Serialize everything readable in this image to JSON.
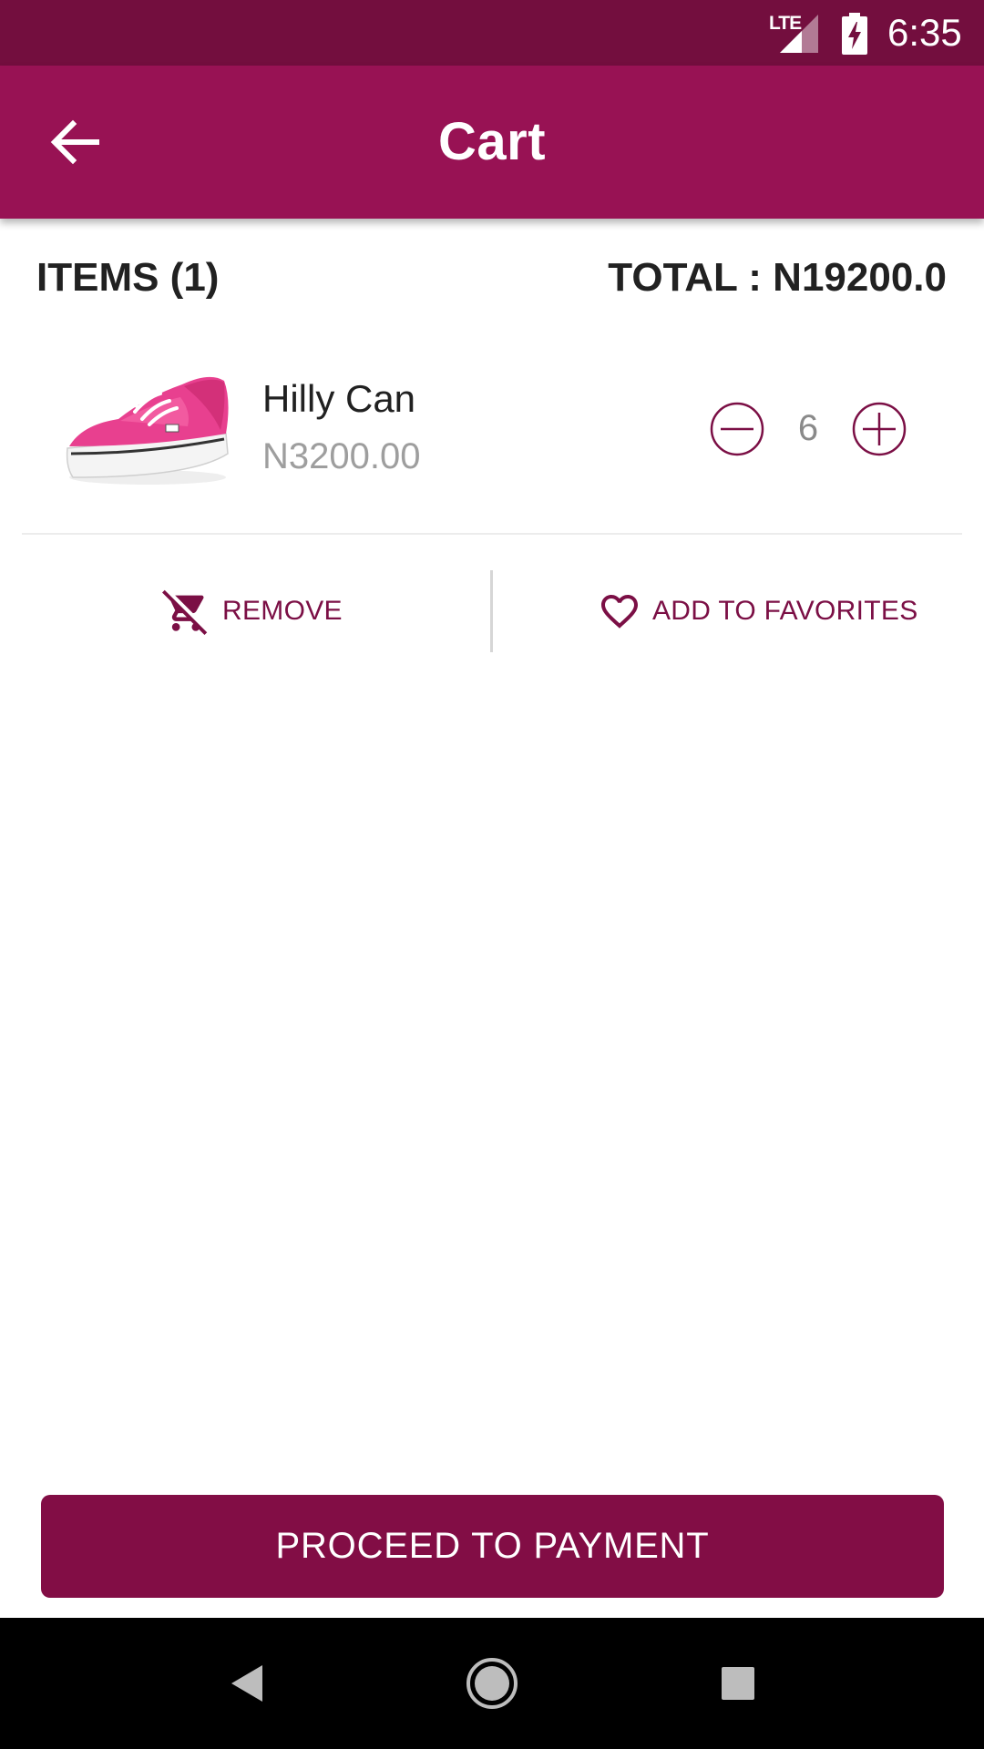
{
  "status_bar": {
    "network": "LTE",
    "time": "6:35"
  },
  "toolbar": {
    "title": "Cart"
  },
  "summary": {
    "items_label": "ITEMS (1)",
    "total_label": "TOTAL : N19200.0"
  },
  "cart_items": [
    {
      "name": "Hilly Can",
      "price": "N3200.00",
      "quantity": "6",
      "thumbnail": "pink-sneaker-image"
    }
  ],
  "actions": {
    "remove_label": "REMOVE",
    "favorites_label": "ADD TO FAVORITES"
  },
  "footer": {
    "proceed_label": "PROCEED TO PAYMENT"
  },
  "colors": {
    "status_bar": "#730e3e",
    "toolbar": "#981254",
    "accent": "#7b0f45",
    "button": "#820d45",
    "nav_bar": "#000000"
  },
  "icons": [
    "lte-signal-icon",
    "battery-charging-icon",
    "back-arrow-icon",
    "minus-circle-icon",
    "plus-circle-icon",
    "remove-cart-icon",
    "heart-outline-icon",
    "nav-back-icon",
    "nav-home-icon",
    "nav-recents-icon"
  ]
}
